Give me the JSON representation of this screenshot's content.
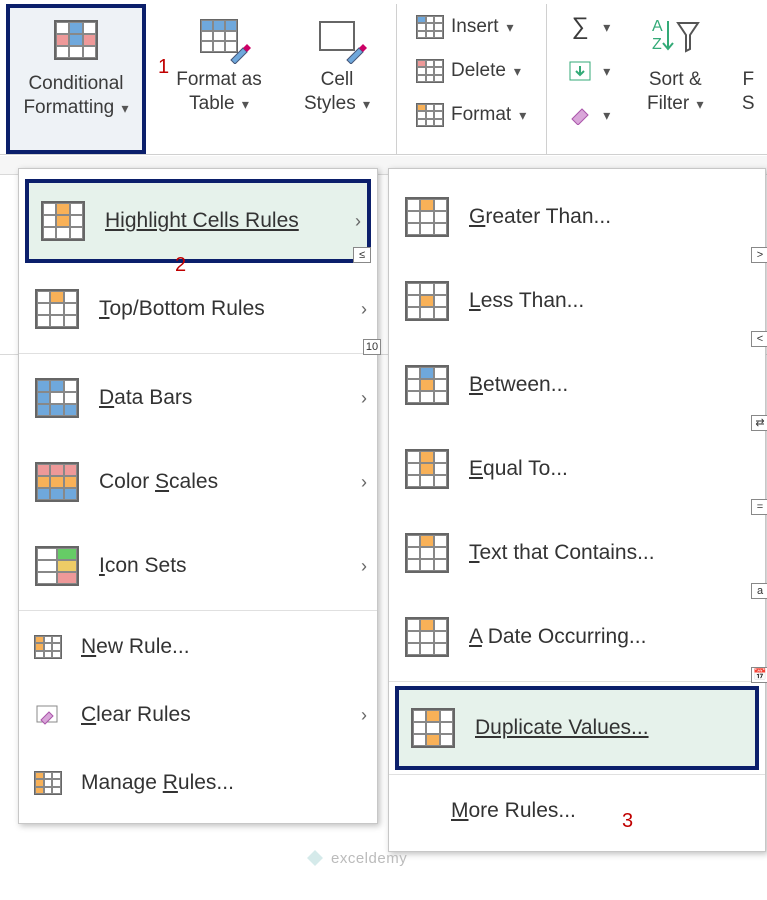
{
  "ribbon": {
    "styles": {
      "conditional_formatting": "Conditional Formatting",
      "format_as_table": "Format as Table",
      "cell_styles": "Cell Styles"
    },
    "cells": {
      "insert": "Insert",
      "delete": "Delete",
      "format": "Format"
    },
    "editing": {
      "sort_filter": "Sort & Filter",
      "find": "F",
      "select": "S"
    }
  },
  "annotations": {
    "a1": "1",
    "a2": "2",
    "a3": "3"
  },
  "menu1": {
    "highlight_cells_rules": "Highlight Cells Rules",
    "top_bottom_rules": "Top/Bottom Rules",
    "data_bars": "Data Bars",
    "color_scales": "Color Scales",
    "icon_sets": "Icon Sets",
    "new_rule": "New Rule...",
    "clear_rules": "Clear Rules",
    "manage_rules": "Manage Rules..."
  },
  "menu2": {
    "greater_than": "Greater Than...",
    "less_than": "Less Than...",
    "between": "Between...",
    "equal_to": "Equal To...",
    "text_contains": "Text that Contains...",
    "date_occurring": "A Date Occurring...",
    "duplicate_values": "Duplicate Values...",
    "more_rules": "More Rules..."
  },
  "watermark": "exceldemy"
}
